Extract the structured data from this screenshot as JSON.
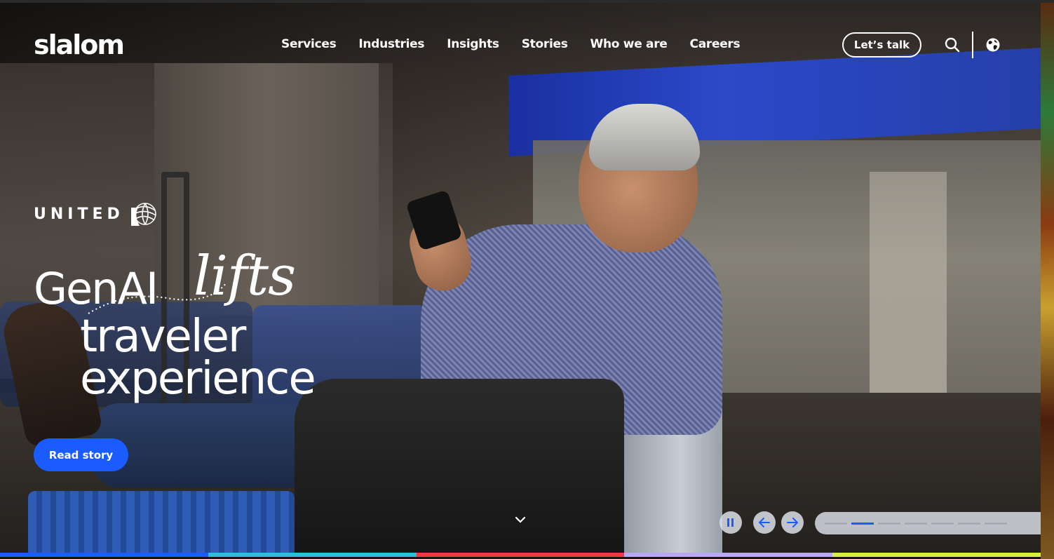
{
  "brand": {
    "logo": "slalom"
  },
  "nav": {
    "items": [
      "Services",
      "Industries",
      "Insights",
      "Stories",
      "Who we are",
      "Careers"
    ],
    "cta_label": "Let’s talk",
    "search_icon": "search-icon",
    "globe_icon": "globe-icon"
  },
  "hero": {
    "client_name": "UNITED",
    "headline": {
      "part1": "GenAI",
      "part2": "lifts",
      "part3": "traveler",
      "part4": "experience"
    },
    "cta_label": "Read story"
  },
  "carousel": {
    "pause_icon": "pause-icon",
    "prev_icon": "arrow-left-icon",
    "next_icon": "arrow-right-icon",
    "scroll_icon": "chevron-down-icon",
    "slide_count": 7,
    "active_slide": 2
  },
  "colors": {
    "accent": "#1a5cff",
    "bar": [
      "#1a5cff",
      "#27c2d8",
      "#ef3a44",
      "#b8a7f2",
      "#d7ef3b"
    ]
  }
}
